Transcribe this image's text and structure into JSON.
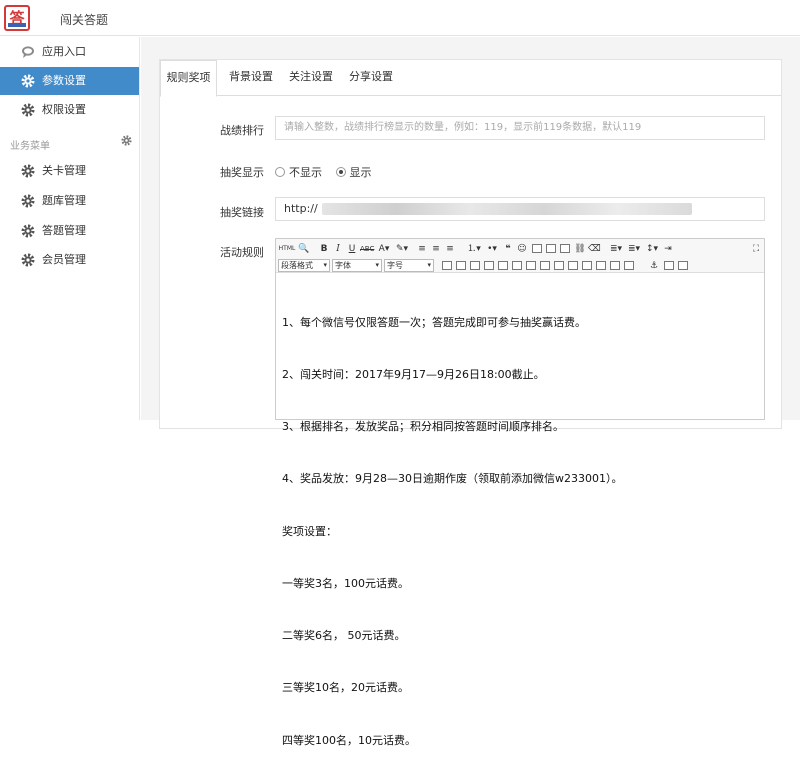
{
  "app": {
    "title": "闯关答题",
    "logo_char": "答"
  },
  "sidebar": {
    "items": [
      {
        "label": "应用入口",
        "icon": "chat-bubble-icon",
        "active": false
      },
      {
        "label": "参数设置",
        "icon": "gear-icon",
        "active": true
      },
      {
        "label": "权限设置",
        "icon": "gear-icon",
        "active": false
      }
    ],
    "section_label": "业务菜单",
    "section_items": [
      {
        "label": "关卡管理",
        "icon": "gear-icon"
      },
      {
        "label": "题库管理",
        "icon": "gear-icon"
      },
      {
        "label": "答题管理",
        "icon": "gear-icon"
      },
      {
        "label": "会员管理",
        "icon": "gear-icon"
      }
    ]
  },
  "tabs": [
    {
      "label": "规则奖项",
      "active": true
    },
    {
      "label": "背景设置",
      "active": false
    },
    {
      "label": "关注设置",
      "active": false
    },
    {
      "label": "分享设置",
      "active": false
    }
  ],
  "form": {
    "ranking": {
      "label": "战绩排行",
      "placeholder": "请输入整数，战绩排行榜显示的数量，例如：119，显示前119条数据，默认119"
    },
    "lottery_display": {
      "label": "抽奖显示",
      "options": [
        "不显示",
        "显示"
      ],
      "selected": "显示"
    },
    "lottery_link": {
      "label": "抽奖链接",
      "value": "http://"
    },
    "rules": {
      "label": "活动规则",
      "toolbar": {
        "html_label": "HTML",
        "paragraph": "段落格式",
        "font": "字体",
        "size": "字号"
      },
      "lines": [
        "1、每个微信号仅限答题一次；答题完成即可参与抽奖赢话费。",
        "2、闯关时间：2017年9月17—9月26日18:00截止。",
        "3、根据排名，发放奖品；积分相同按答题时间顺序排名。",
        "4、奖品发放：9月28—30日逾期作废（领取前添加微信w233001）。",
        "奖项设置：",
        "一等奖3名，100元话费。",
        "二等奖6名， 50元话费。",
        "三等奖10名，20元话费。",
        "四等奖100名，10元话费。"
      ]
    }
  }
}
